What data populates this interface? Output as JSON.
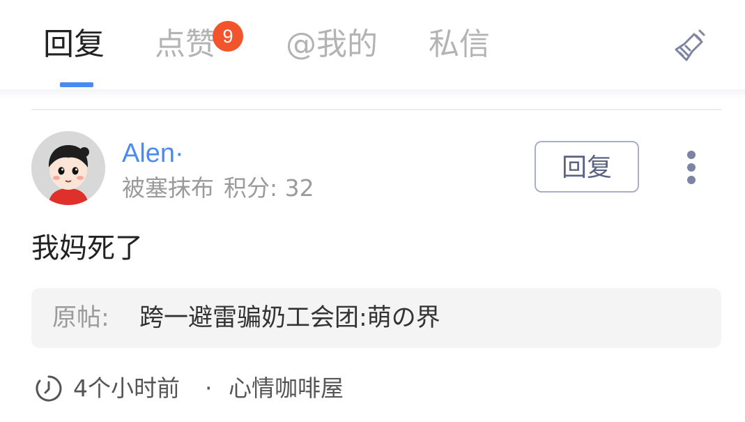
{
  "tabs": [
    {
      "label": "回复",
      "active": true
    },
    {
      "label": "点赞",
      "active": false,
      "badge": "9"
    },
    {
      "label": "@我的",
      "active": false
    },
    {
      "label": "私信",
      "active": false
    }
  ],
  "header": {
    "clear_icon": "broom-icon"
  },
  "message": {
    "username": "Alen·",
    "user_title": "被塞抹布",
    "points_label": "积分: 32",
    "reply_button": "回复",
    "more_icon": "more-vertical-icon",
    "content": "我妈死了",
    "origin_label": "原帖:",
    "origin_title": "跨一避雷骗奶工会团:萌の界",
    "time": "4个小时前",
    "separator": "·",
    "forum": "心情咖啡屋",
    "time_icon": "clock-icon"
  },
  "colors": {
    "accent": "#4a8af4",
    "badge": "#f2552c",
    "active_tab": "#222222",
    "inactive_tab": "#b3b3b3",
    "button_border": "#a9aec8"
  }
}
